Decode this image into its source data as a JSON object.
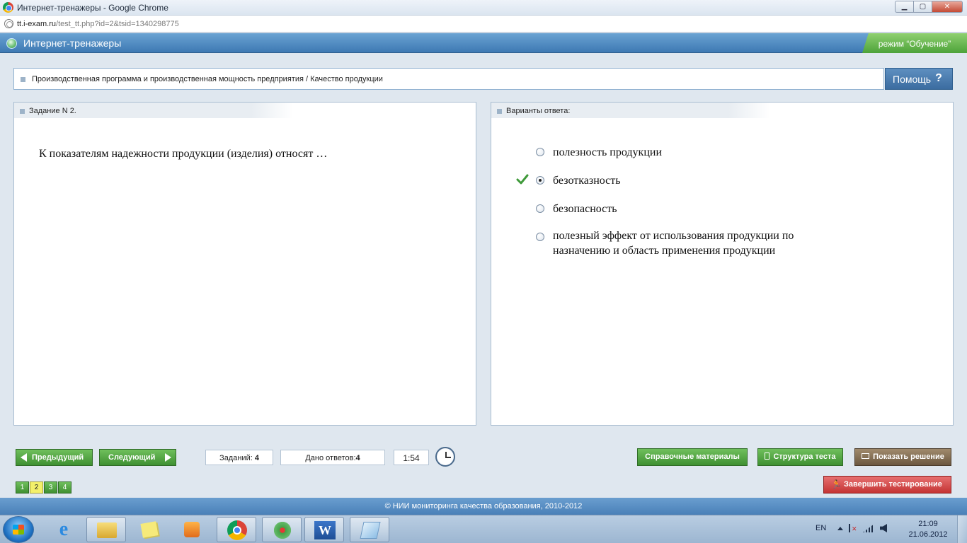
{
  "window": {
    "title": "Интернет-тренажеры - Google Chrome",
    "min_glyph": "▁",
    "max_glyph": "▢",
    "close_glyph": "✕"
  },
  "address": {
    "host": "tt.i-exam.ru",
    "path": "/test_tt.php?id=2&tsid=1340298775"
  },
  "app": {
    "title": "Интернет-тренажеры",
    "mode": "режим “Обучение”"
  },
  "breadcrumb": {
    "text": "Производственная программа и производственная мощность предприятия / Качество продукции"
  },
  "help": {
    "label": "Помощь",
    "icon_glyph": "?"
  },
  "task_panel": {
    "header": "Задание N 2.",
    "question": "К показателям надежности продукции (изделия) относят …"
  },
  "answers_panel": {
    "header": "Варианты ответа:",
    "options": [
      {
        "label": "полезность продукции",
        "selected": false
      },
      {
        "label": "безотказность",
        "selected": true
      },
      {
        "label": "безопасность",
        "selected": false
      },
      {
        "label": "полезный эффект от использования продукции по назначению и область применения продукции",
        "selected": false
      }
    ]
  },
  "controls": {
    "prev_label": "Предыдущий",
    "next_label": "Следующий",
    "tasks_label": "Заданий:",
    "tasks_count": "4",
    "answered_label": "Дано ответов:",
    "answered_count": "4",
    "timer": "1:54",
    "ref_label": "Справочные материалы",
    "structure_label": "Структура теста",
    "solution_label": "Показать решение",
    "finish_label": "Завершить тестирование",
    "pages": [
      "1",
      "2",
      "3",
      "4"
    ],
    "current_page": "2"
  },
  "footer": {
    "text": "© НИИ мониторинга качества образования, 2010-2012"
  },
  "taskbar": {
    "lang": "EN",
    "time": "21:09",
    "date": "21.06.2012",
    "ie_glyph": "e",
    "word_glyph": "W",
    "finish_icon_glyph": "🏃"
  }
}
